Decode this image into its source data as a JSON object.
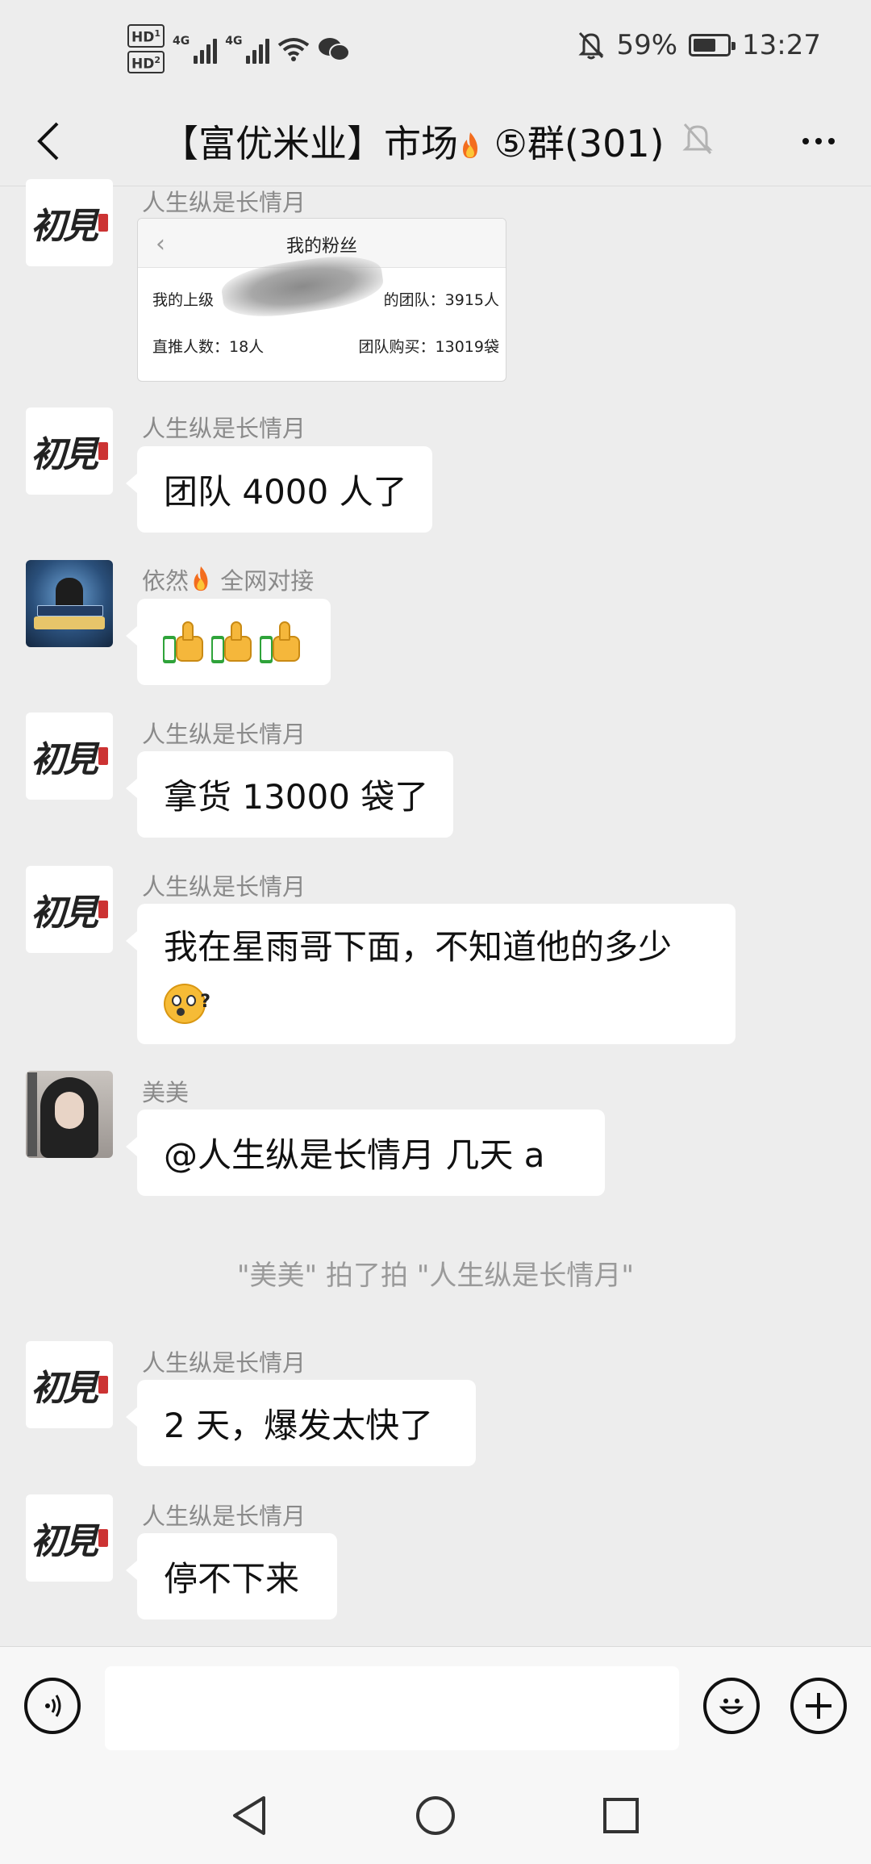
{
  "status_bar": {
    "hd1": "HD",
    "hd1_sub": "1",
    "hd2": "HD",
    "hd2_sub": "2",
    "net1": "4G",
    "net2": "4G",
    "battery_percent": "59%",
    "battery_level": 0.59,
    "time": "13:27"
  },
  "header": {
    "title_part1": "【富优米业】市场",
    "title_part2": " ⑤群(301)"
  },
  "messages": [
    {
      "sender": "人生纵是长情月",
      "type": "image",
      "screenshot": {
        "title": "我的粉丝",
        "row1_left": "我的上级",
        "row1_right": "的团队：3915人",
        "row2_left": "直推人数：18人",
        "row2_right": "团队购买：13019袋"
      }
    },
    {
      "sender": "人生纵是长情月",
      "text": "团队 4000 人了"
    },
    {
      "sender_name": "依然",
      "sender_suffix": " 全网对接",
      "type": "emoji",
      "emoji_name": "thumbs-up",
      "emoji_count": 3
    },
    {
      "sender": "人生纵是长情月",
      "text": "拿货 13000 袋了"
    },
    {
      "sender": "人生纵是长情月",
      "text_line1": "我在星雨哥下面，不知道他的多少"
    },
    {
      "sender": "美美",
      "text": "@人生纵是长情月  几天 a"
    },
    {
      "sender": "人生纵是长情月",
      "text": "2 天，爆发太快了"
    },
    {
      "sender": "人生纵是长情月",
      "text": "停不下来"
    }
  ],
  "system_message": "\"美美\" 拍了拍 \"人生纵是长情月\"",
  "input": {
    "value": "",
    "placeholder": ""
  },
  "icons": [
    "hd-icon",
    "signal-icon",
    "wifi-icon",
    "wechat-icon",
    "mute-icon",
    "battery-icon",
    "back-arrow-icon",
    "fire-emoji",
    "muted-bell-icon",
    "more-icon",
    "voice-icon",
    "emoji-icon",
    "plus-icon",
    "nav-back-icon",
    "nav-home-icon",
    "nav-recents-icon"
  ]
}
